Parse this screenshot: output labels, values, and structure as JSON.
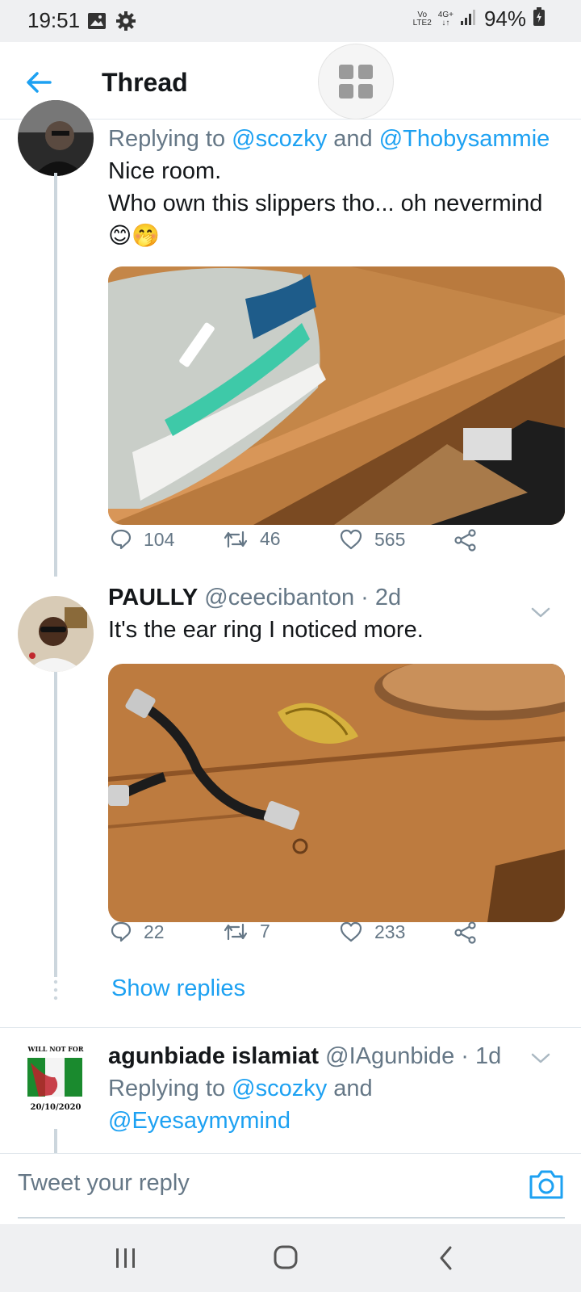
{
  "status_bar": {
    "time": "19:51",
    "network_top": "Vo",
    "network_bottom": "LTE2",
    "network_type": "4G+",
    "battery": "94%",
    "icons": [
      "image-icon",
      "gear-icon",
      "signal-icon",
      "battery-icon"
    ]
  },
  "header": {
    "title": "Thread",
    "back_icon": "arrow-left-icon",
    "badge_icon": "grid-icon"
  },
  "tweets": [
    {
      "reply_prefix": "Replying to",
      "reply_mention_1": "@scozky",
      "reply_and": " and ",
      "reply_mention_2": "@Thobysammie",
      "text_line_1": "Nice room.",
      "text_line_2": "Who own this slippers tho... oh nevermind",
      "emoji": "😊🤭",
      "media_description_icon": "photo-sneaker-on-shelf",
      "replies": "104",
      "retweets": "46",
      "likes": "565"
    },
    {
      "name": "PAULLY",
      "handle": "@ceecibanton",
      "sep": " · ",
      "time": "2d",
      "text": "It's the ear ring I noticed more.",
      "media_description_icon": "photo-bracelet-earring",
      "replies": "22",
      "retweets": "7",
      "likes": "233",
      "show_replies": "Show replies"
    },
    {
      "name": "agunbiade islamiat",
      "handle": "@IAgunbide",
      "sep": " · ",
      "time": "1d",
      "reply_prefix": "Replying to",
      "reply_mention_1": "@scozky",
      "reply_and": " and",
      "reply_mention_2": "@Eyesaymymind",
      "avatar_top_text": "WILL NOT FOR",
      "avatar_date": "20/10/2020"
    }
  ],
  "reply_bar": {
    "placeholder": "Tweet your reply",
    "camera_icon": "camera-icon"
  },
  "colors": {
    "accent": "#1da1f2",
    "muted": "#657786",
    "text": "#14171a",
    "status_bg": "#eff0f2"
  }
}
